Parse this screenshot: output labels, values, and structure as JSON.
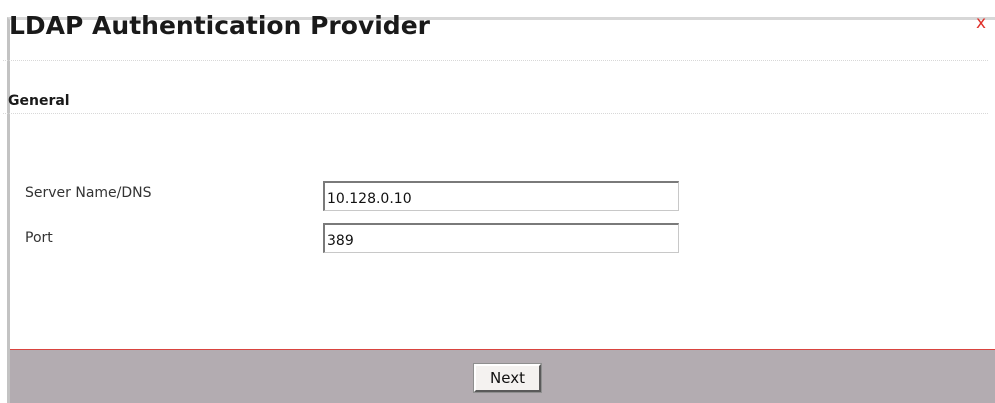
{
  "dialog": {
    "title": "LDAP Authentication Provider",
    "close_icon": "close-icon",
    "close_glyph": "x",
    "accent_color": "#e0302a"
  },
  "section": {
    "label": "General"
  },
  "form": {
    "server": {
      "label": "Server Name/DNS",
      "value": "10.128.0.10"
    },
    "port": {
      "label": "Port",
      "value": "389"
    }
  },
  "footer": {
    "next_label": "Next",
    "background_color": "#b3acb1",
    "divider_color": "#d9443f"
  }
}
